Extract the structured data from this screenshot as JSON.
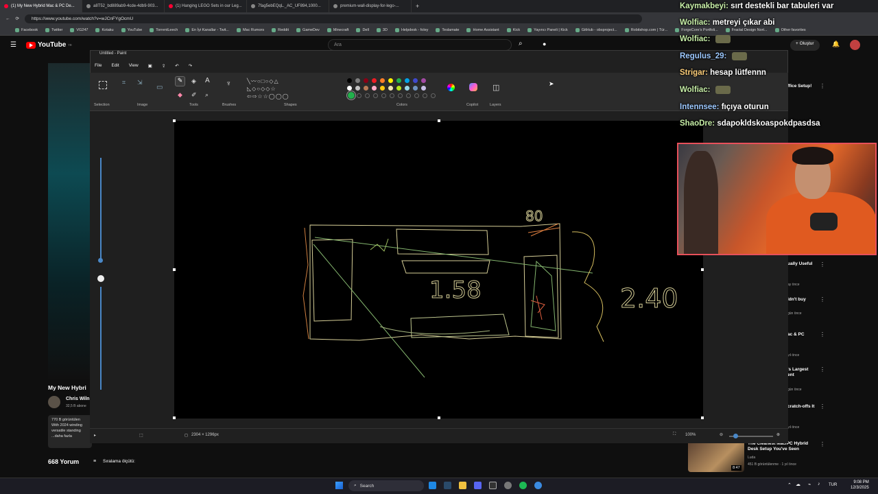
{
  "browser": {
    "tabs": [
      {
        "label": "(1) My New Hybrid Mac & PC De..."
      },
      {
        "label": "a8T52_bd889ab9-4cde-4db9-903..."
      },
      {
        "label": "(1) Hanging LEGO Sets in our Leg..."
      },
      {
        "label": "7fag5ebEQqL._AC_UF894,1000..."
      },
      {
        "label": "premium-wall-display-for-lego-..."
      }
    ],
    "url": "https://www.youtube.com/watch?v=wJCnFYgOcmU",
    "bookmarks": [
      "Facebook",
      "Twitter",
      "VG247",
      "Kotaku",
      "YouTube",
      "TorrentLeech",
      "En İyi Kanallar - Twit...",
      "Mac Rumors",
      "Reddit",
      "GameDev",
      "Minecraft",
      "Dell",
      "3D",
      "Helpdesk - foley",
      "Teslamate",
      "Home Assistant",
      "Kick",
      "Yayıncı Paneli | Kick",
      "GitHub - obsproject...",
      "Robitshop.com | Tür...",
      "ForgeCore's Portfoli...",
      "Fractal Design Nort...",
      "Other favorites"
    ]
  },
  "youtube": {
    "logo": "YouTube",
    "logo_suffix": "TR",
    "search_placeholder": "Ara",
    "create_label": "Oluştur",
    "video_title": "My New Hybri",
    "channel_name": "Chris Wiln",
    "channel_subs": "32,5 B abone",
    "description": [
      "770 B görüntülen",
      "With 2024 winding",
      "versatile standing",
      "...daha fazla"
    ],
    "comments_count": "668 Yorum",
    "sort_label": "Sıralama ölçütü:",
    "sidebar": [
      {
        "title": "ffice Setup!",
        "meta": ""
      },
      {
        "title": "ually Useful",
        "meta": "ay önce"
      },
      {
        "title": "ldn't buy",
        "meta": "gün önce"
      },
      {
        "title": "ac & PC",
        "meta": "yıl önce"
      },
      {
        "title": "'s Largest\nent",
        "meta": "gün önce"
      },
      {
        "title": "cratch-offs It",
        "meta": "yıl önce"
      }
    ],
    "bottom_video": {
      "title": "The Cleanest Mac/PC Hybrid Desk Setup You've Seen",
      "channel": "Luda",
      "meta": "451 B görüntülenme · 1 yıl önce",
      "duration": "8:47"
    }
  },
  "paint": {
    "window_title": "Untitled - Paint",
    "menu": [
      "File",
      "Edit",
      "View"
    ],
    "groups": [
      "Selection",
      "Image",
      "Tools",
      "Brushes",
      "Shapes",
      "Colors",
      "Copilot",
      "Layers"
    ],
    "canvas_size": "2304 × 1296px",
    "zoom": "100%",
    "colors_row1": [
      "#000000",
      "#7f7f7f",
      "#880015",
      "#ed1c24",
      "#ff7f27",
      "#fff200",
      "#22b14c",
      "#00a2e8",
      "#3f48cc",
      "#a349a4"
    ],
    "colors_row2": [
      "#ffffff",
      "#c3c3c3",
      "#b97a57",
      "#ffaec9",
      "#ffc90e",
      "#efe4b0",
      "#b5e61d",
      "#99d9ea",
      "#7092be",
      "#c8bfe7"
    ],
    "active_color": "#22b14c",
    "drawing_labels": [
      "1.58",
      "2.40",
      "80"
    ]
  },
  "chat": [
    {
      "user": "Kaymakbeyi:",
      "msg": "sırt destekli bar tabuleri var",
      "tone": "g"
    },
    {
      "user": "Wolfiac:",
      "msg": "metreyi çıkar abi",
      "tone": "g"
    },
    {
      "user": "Wolfiac:",
      "msg": "",
      "tone": "g"
    },
    {
      "user": "Regulus_29:",
      "msg": "",
      "tone": "b"
    },
    {
      "user": "Strigar:",
      "msg": "hesap lütfennn",
      "tone": "o"
    },
    {
      "user": "Wolfiac:",
      "msg": "",
      "tone": "g"
    },
    {
      "user": "Intennsee:",
      "msg": "fıçıya oturun",
      "tone": "b"
    },
    {
      "user": "ShaoDre:",
      "msg": "sdapokldskoaspokdpasdsa",
      "tone": "g"
    }
  ],
  "taskbar": {
    "search": "Search",
    "lang": "TUR",
    "time": "9:08 PM",
    "date": "12/3/2025"
  }
}
